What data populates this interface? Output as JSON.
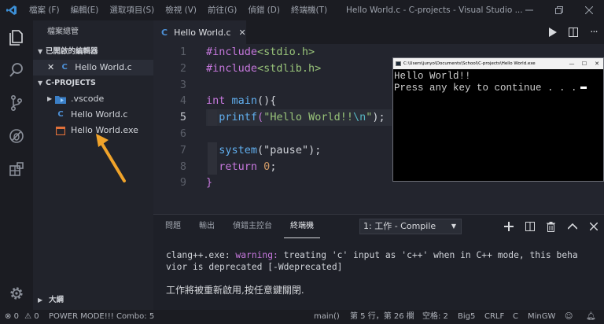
{
  "titlebar": {
    "menu": [
      "檔案 (F)",
      "編輯(E)",
      "選取項目(S)",
      "檢視 (V)",
      "前往(G)",
      "偵錯 (D)",
      "終端機(T)"
    ],
    "title": "Hello World.c - C-projects - Visual Studio ..."
  },
  "sidebar": {
    "header": "檔案總管",
    "open_editors_label": "已開啟的編輯器",
    "open_editors": [
      {
        "label": "Hello World.c",
        "icon": "C"
      }
    ],
    "folder_label": "C-PROJECTS",
    "tree": [
      {
        "label": ".vscode",
        "icon": "folder-icon"
      },
      {
        "label": "Hello World.c",
        "icon": "C"
      },
      {
        "label": "Hello World.exe",
        "icon": "exe-icon"
      }
    ],
    "outline_label": "大綱"
  },
  "editor": {
    "tab_label": "Hello World.c",
    "tab_icon": "C",
    "line_numbers": [
      "1",
      "2",
      "3",
      "4",
      "5",
      "6",
      "7",
      "8",
      "9"
    ],
    "code": {
      "l1a": "#include",
      "l1b": "<stdio.h>",
      "l2a": "#include",
      "l2b": "<stdlib.h>",
      "l4a": "int",
      "l4b": " main",
      "l4c": "(){",
      "l5a": "printf",
      "l5b": "(",
      "l5c": "\"Hello World!!",
      "l5d": "\\n",
      "l5e": "\"",
      "l5f": ");",
      "l7a": "system",
      "l7b": "(\"pause\");",
      "l8a": "return",
      "l8b": " 0",
      "l8c": ";",
      "l9a": "}"
    }
  },
  "console": {
    "title": "C:\\Users\\junyo\\Documents\\School\\C-projects\\Hello World.exe",
    "line1": "Hello World!!",
    "line2": "Press any key to continue . . ."
  },
  "panel": {
    "tabs": [
      "問題",
      "輸出",
      "偵錯主控台",
      "終端機"
    ],
    "active_tab_index": 3,
    "select_value": "1: 工作 - Compile",
    "out_prefix": "clang++.exe: ",
    "out_warning": "warning:",
    "out_rest1": " treating 'c' input as 'c++' when in C++ mode, this beha",
    "out_line2": "vior is deprecated [-Wdeprecated]",
    "out_line3": "工作將被重新啟用,按任意鍵關閉."
  },
  "status": {
    "errors": "0",
    "warnings": "0",
    "power_mode": "POWER MODE!!! Combo: 5",
    "function": "main()",
    "position": "第 5 行，第 26 欄",
    "spaces": "空格: 2",
    "encoding": "Big5",
    "eol": "CRLF",
    "language": "C",
    "compiler": "MinGW"
  },
  "colors": {
    "accent_blue": "#4d90d6",
    "arrow_orange": "#f0a32a",
    "keyword": "#c678dd",
    "function": "#61afef",
    "string": "#98c379"
  }
}
